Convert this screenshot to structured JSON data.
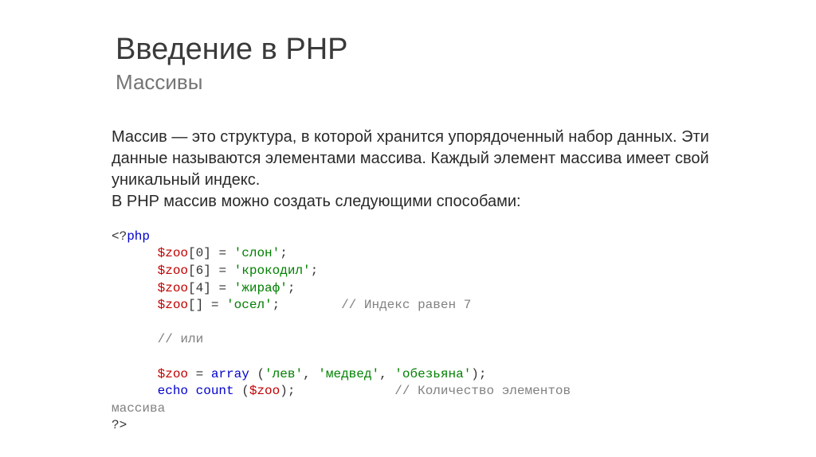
{
  "title": {
    "main": "Введение в PHP",
    "sub": "Массивы"
  },
  "paragraph": "Массив — это структура, в которой хранится упорядоченный набор данных. Эти данные называются элементами массива. Каждый элемент массива имеет свой уникальный индекс.\nВ PHP массив можно создать следующими способами:",
  "code": {
    "line1": {
      "open": "<?",
      "kw": "php"
    },
    "line2": {
      "indent": "      ",
      "var": "$zoo",
      "bracket_open": "[",
      "idx": "0",
      "bracket_close": "] = ",
      "str": "'слон'",
      "semi": ";"
    },
    "line3": {
      "indent": "      ",
      "var": "$zoo",
      "bracket_open": "[",
      "idx": "6",
      "bracket_close": "] = ",
      "str": "'крокодил'",
      "semi": ";"
    },
    "line4": {
      "indent": "      ",
      "var": "$zoo",
      "bracket_open": "[",
      "idx": "4",
      "bracket_close": "] = ",
      "str": "'жираф'",
      "semi": ";"
    },
    "line5": {
      "indent": "      ",
      "var": "$zoo",
      "bracket_close": "[] = ",
      "str": "'осел'",
      "semi": ";",
      "pad": "        ",
      "cmt": "// Индекс равен 7"
    },
    "line7": {
      "indent": "      ",
      "cmt": "// или"
    },
    "line9": {
      "indent": "      ",
      "var": "$zoo",
      "eq": " = ",
      "fn": "array",
      "paren_open": " (",
      "str1": "'лев'",
      "comma1": ", ",
      "str2": "'медвед'",
      "comma2": ", ",
      "str3": "'обезьяна'",
      "paren_close": ");"
    },
    "line10": {
      "indent": "      ",
      "kw": "echo",
      "sp": " ",
      "fn": "count",
      "paren_open": " (",
      "var": "$zoo",
      "paren_close": ");",
      "pad": "             ",
      "cmt": "// Количество элементов"
    },
    "line11": {
      "cmt": "массива"
    },
    "line12": {
      "close": "?>"
    }
  }
}
